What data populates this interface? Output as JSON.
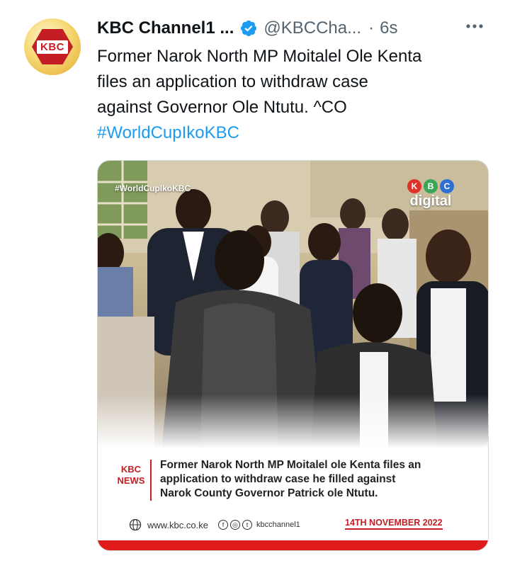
{
  "account": {
    "display_name": "KBC Channel1 ...",
    "handle": "@KBCCha...",
    "separator": "·",
    "time": "6s",
    "avatar_text": "KBC",
    "verified_icon": "verified-badge-icon",
    "more_icon": "more-dots-icon"
  },
  "tweet": {
    "text_lines": [
      "Former Narok North MP Moitalel Ole Kenta",
      "files an application to withdraw case",
      "against Governor Ole Ntutu. ^CO"
    ],
    "hashtag": "#WorldCupIkoKBC"
  },
  "media": {
    "photo_tag": "#WorldCupIkoKBC",
    "digital_letters": [
      "K",
      "B",
      "C"
    ],
    "digital_word": "digital",
    "news_label_line1": "KBC",
    "news_label_line2": "NEWS",
    "caption_lines": [
      "Former Narok North MP Moitalel ole Kenta files an",
      "application to withdraw case he filled against",
      "Narok County Governor Patrick ole Ntutu."
    ],
    "website": "www.kbc.co.ke",
    "social_icons": [
      "facebook-icon",
      "instagram-icon",
      "twitter-icon"
    ],
    "social_handle": "kbcchannel1",
    "date": "14TH NOVEMBER 2022"
  },
  "colors": {
    "link_blue": "#1d9bf0",
    "secondary_text": "#536471",
    "kbc_red": "#c41e24",
    "digital_k": "#e0312b",
    "digital_b": "#3aa655",
    "digital_c": "#2f6fd1"
  }
}
